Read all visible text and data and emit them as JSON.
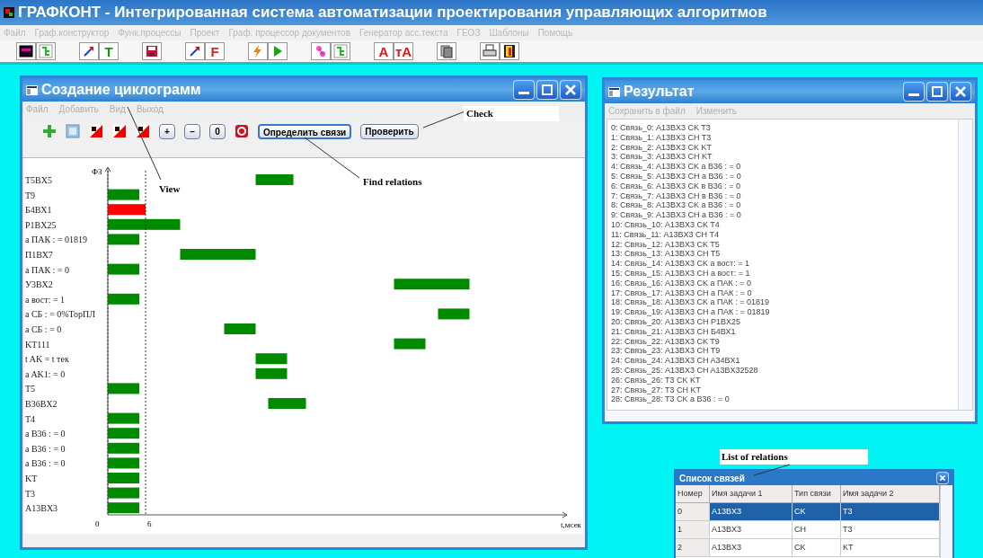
{
  "app": {
    "title": "ГРАФКОНТ - Интегрированная система автоматизации проектирования управляющих алгоритмов",
    "menu": [
      {
        "label": "Файл",
        "disabled": true
      },
      {
        "label": "Граф.конструктор",
        "disabled": true
      },
      {
        "label": "Функ.процессы",
        "disabled": true
      },
      {
        "label": "Проект",
        "disabled": true
      },
      {
        "label": "Граф. процессор документов",
        "disabled": true
      },
      {
        "label": "Генератор асс.текста",
        "disabled": true
      },
      {
        "label": "ГЕОЗ",
        "disabled": true
      },
      {
        "label": "Шаблоны",
        "disabled": true
      },
      {
        "label": "Помощь",
        "disabled": true
      }
    ],
    "toolbar": [
      [
        {
          "kind": "monitor"
        },
        {
          "kind": "tree"
        }
      ],
      [
        {
          "kind": "arrow"
        },
        {
          "kind": "letter",
          "text": "T",
          "color": "#119911"
        }
      ],
      [
        {
          "kind": "floppy"
        }
      ],
      [
        {
          "kind": "arrow"
        },
        {
          "kind": "letter",
          "text": "F",
          "color": "#dd2222"
        }
      ],
      [
        {
          "kind": "bolt"
        },
        {
          "kind": "play"
        }
      ],
      [
        {
          "kind": "graph"
        },
        {
          "kind": "tree"
        }
      ],
      [
        {
          "kind": "letter",
          "text": "A",
          "color": "#ee1111"
        },
        {
          "kind": "letter",
          "text": "тA",
          "color": "#ee1111"
        }
      ],
      [
        {
          "kind": "copy"
        }
      ],
      [
        {
          "kind": "printer"
        },
        {
          "kind": "door"
        }
      ]
    ]
  },
  "cyclogram_window": {
    "title": "Создание циклограмм",
    "menu": [
      {
        "label": "Файл",
        "disabled": true
      },
      {
        "label": "Добавить",
        "disabled": true
      },
      {
        "label": "Вид",
        "disabled": true
      },
      {
        "label": "Выход",
        "disabled": true
      }
    ],
    "toolbar": [
      {
        "kind": "add"
      },
      {
        "kind": "frame"
      },
      {
        "kind": "flag"
      },
      {
        "kind": "flag"
      },
      {
        "kind": "flag"
      },
      {
        "kind": "button",
        "text": "+"
      },
      {
        "kind": "button",
        "text": "–"
      },
      {
        "kind": "button",
        "text": "0"
      },
      {
        "kind": "stop"
      },
      {
        "kind": "button",
        "text": "Определить связи",
        "focused": true
      },
      {
        "kind": "button",
        "text": "Проверить",
        "focused": false
      }
    ],
    "cyclogram": {
      "xlabel": "t,мсек",
      "ylabel": "ФЗ",
      "ticks": [
        "0",
        "6"
      ],
      "rows": [
        {
          "label": "T5BX5",
          "highlighted": false
        },
        {
          "label": "T9",
          "highlighted": false
        },
        {
          "label": "Б4ВХ1",
          "highlighted": true
        },
        {
          "label": "P1BX25",
          "highlighted": false
        },
        {
          "label": "a ПАК : = 01819",
          "highlighted": false
        },
        {
          "label": "П1ВХ7",
          "highlighted": false
        },
        {
          "label": "a ПАК : = 0",
          "highlighted": false
        },
        {
          "label": "У3ВХ2",
          "highlighted": false
        },
        {
          "label": "a вост: = 1",
          "highlighted": false
        },
        {
          "label": "a СБ : = 0%TopПЛ",
          "highlighted": false
        },
        {
          "label": "a СБ : = 0",
          "highlighted": false
        },
        {
          "label": "KT111",
          "highlighted": false
        },
        {
          "label": "t AK = t тек",
          "highlighted": false
        },
        {
          "label": "a AK1: = 0",
          "highlighted": false
        },
        {
          "label": "T5",
          "highlighted": false
        },
        {
          "label": "B36BX2",
          "highlighted": false
        },
        {
          "label": "T4",
          "highlighted": false
        },
        {
          "label": "a B36 : = 0",
          "highlighted": false
        },
        {
          "label": "a B36 : = 0",
          "highlighted": false
        },
        {
          "label": "a B36 : = 0",
          "highlighted": false
        },
        {
          "label": "KT",
          "highlighted": false
        },
        {
          "label": "T3",
          "highlighted": false
        },
        {
          "label": "A13BX3",
          "highlighted": false
        }
      ]
    }
  },
  "result_window": {
    "title": "Результат",
    "menu": [
      {
        "label": "Сохранить в файл",
        "disabled": true
      },
      {
        "label": "Изменить",
        "disabled": true
      }
    ],
    "lines": [
      "0: Связь_0: A13BX3 CK T3",
      "1: Связь_1: A13BX3 CH T3",
      "2: Связь_2: A13BX3 CK KT",
      "3: Связь_3: A13BX3 CH KT",
      "4: Связь_4: A13BX3 CK a B36 : = 0",
      "5: Связь_5: A13BX3 CH a B36 : = 0",
      "6: Связь_6: A13BX3 CK в B36 : = 0",
      "7: Связь_7: A13BX3 CH в B36 : = 0",
      "8: Связь_8: A13BX3 CK a B36 : = 0",
      "9: Связь_9: A13BX3 CH a B36 : = 0",
      "10: Связь_10: A13BX3 CK T4",
      "11: Связь_11: A13BX3 CH T4",
      "12: Связь_12: A13BX3 CK T5",
      "13: Связь_13: A13BX3 CH T5",
      "14: Связь_14: A13BX3 CK a вост: = 1",
      "15: Связь_15: A13BX3 CH a вост: = 1",
      "16: Связь_16: A13BX3 CK a ПАК : = 0",
      "17: Связь_17: A13BX3 CH a ПАК : = 0",
      "18: Связь_18: A13BX3 CK a ПАК : = 01819",
      "19: Связь_19: A13BX3 CH a ПАК : = 01819",
      "20: Связь_20: A13BX3 CH P1BX25",
      "21: Связь_21: A13BX3 CH Б4ВХ1",
      "22: Связь_22: A13BX3 CK T9",
      "23: Связь_23: A13BX3 CH T9",
      "24: Связь_24: A13BX3 CH A34BX1",
      "25: Связь_25: A13BX3 CH A13BX32528",
      "26: Связь_26: T3 CK KT",
      "27: Связь_27: T3 CH KT",
      "28: Связь_28: T3 CK a B36 : = 0"
    ]
  },
  "relations_window": {
    "title": "Список связей",
    "columns": [
      "Номер",
      "Имя задачи 1",
      "Тип связи",
      "Имя задачи 2"
    ],
    "rows": [
      {
        "cells": [
          "0",
          "A13BX3",
          "CK",
          "T3"
        ],
        "selected": true
      },
      {
        "cells": [
          "1",
          "A13BX3",
          "CH",
          "T3"
        ],
        "selected": false
      },
      {
        "cells": [
          "2",
          "A13BX3",
          "CK",
          "KT"
        ],
        "selected": false
      }
    ]
  },
  "annotations": [
    "View",
    "Find relations",
    "Check",
    "List of relations"
  ]
}
